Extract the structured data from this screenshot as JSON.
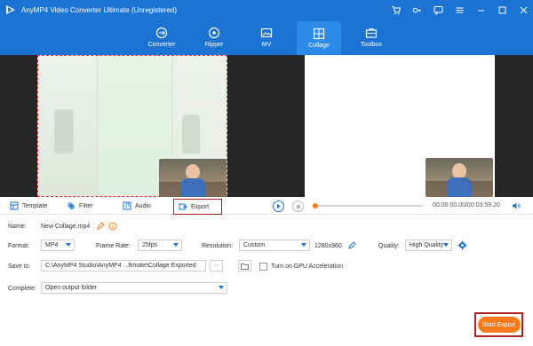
{
  "app": {
    "title": "AnyMP4 Video Converter Ultimate (Unregistered)"
  },
  "nav": {
    "items": [
      {
        "label": "Converter",
        "icon": "converter-icon"
      },
      {
        "label": "Ripper",
        "icon": "ripper-icon"
      },
      {
        "label": "MV",
        "icon": "mv-icon"
      },
      {
        "label": "Collage",
        "icon": "collage-icon"
      },
      {
        "label": "Toolbox",
        "icon": "toolbox-icon"
      }
    ],
    "active": "Collage"
  },
  "tabs": {
    "template": "Template",
    "filter": "Filter",
    "audio": "Audio",
    "export": "Export"
  },
  "player": {
    "time": "00:00:00.00/00:03:59.20",
    "progress": 0.02
  },
  "settings": {
    "name_label": "Name:",
    "name_value": "New Collage.mp4",
    "format_label": "Format:",
    "format_value": "MP4",
    "framerate_label": "Frame Rate:",
    "framerate_value": "25fps",
    "resolution_label": "Resolution:",
    "resolution_value": "Custom",
    "resolution_size": "1280x960",
    "quality_label": "Quality:",
    "quality_value": "High Quality",
    "saveto_label": "Save to:",
    "saveto_value": "C:\\AnyMP4 Studio\\AnyMP4 ...ltimate\\Collage Exported",
    "browse_label": "···",
    "gpu_label": "Turn on GPU Acceleration",
    "complete_label": "Complete:",
    "complete_value": "Open output folder"
  },
  "actions": {
    "start_export": "Start Export"
  },
  "colors": {
    "header": "#1b73d3",
    "accent": "#ff7a1a",
    "highlight_border": "#b02020"
  }
}
